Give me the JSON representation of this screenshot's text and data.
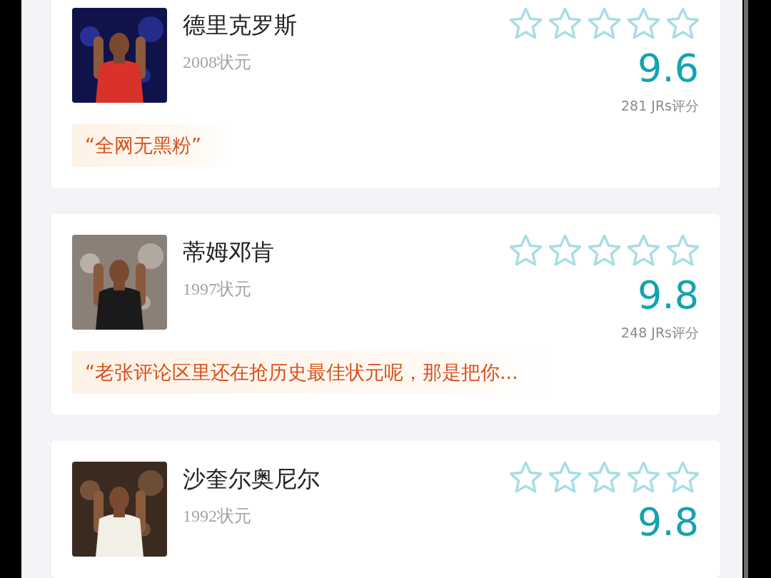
{
  "players": [
    {
      "name": "德里克罗斯",
      "draft": "2008状元",
      "stars": 0,
      "score": "9.6",
      "count": "281 JRs评分",
      "quote": "“全网无黑粉”"
    },
    {
      "name": "蒂姆邓肯",
      "draft": "1997状元",
      "stars": 0,
      "score": "9.8",
      "count": "248 JRs评分",
      "quote": "“老张评论区里还在抢历史最佳状元呢，那是把你..."
    },
    {
      "name": "沙奎尔奥尼尔",
      "draft": "1992状元",
      "stars": 0,
      "score": "9.8"
    }
  ]
}
